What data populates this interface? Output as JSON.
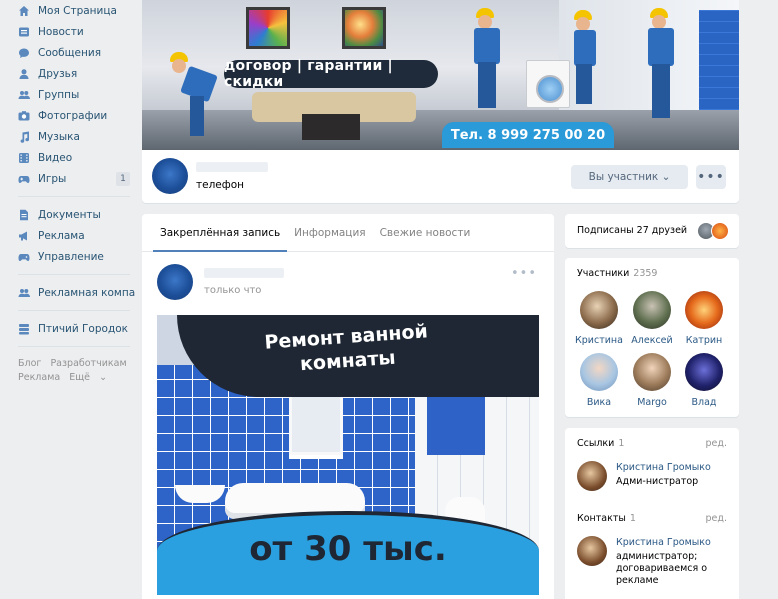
{
  "sidebar": {
    "items": [
      {
        "label": "Моя Страница",
        "icon": "home-icon"
      },
      {
        "label": "Новости",
        "icon": "news-icon"
      },
      {
        "label": "Сообщения",
        "icon": "messages-icon"
      },
      {
        "label": "Друзья",
        "icon": "friends-icon"
      },
      {
        "label": "Группы",
        "icon": "groups-icon"
      },
      {
        "label": "Фотографии",
        "icon": "photos-icon"
      },
      {
        "label": "Музыка",
        "icon": "music-icon"
      },
      {
        "label": "Видео",
        "icon": "video-icon"
      },
      {
        "label": "Игры",
        "icon": "games-icon",
        "badge": "1"
      }
    ],
    "items2": [
      {
        "label": "Документы",
        "icon": "documents-icon"
      },
      {
        "label": "Реклама",
        "icon": "ads-icon"
      },
      {
        "label": "Управление",
        "icon": "management-icon"
      }
    ],
    "items3": [
      {
        "label": "Рекламная компа",
        "icon": "ad-company-icon"
      }
    ],
    "items4": [
      {
        "label": "Птичий Городок",
        "icon": "bird-town-icon"
      }
    ],
    "footer": [
      "Блог",
      "Разработчикам",
      "Реклама",
      "Ещё"
    ]
  },
  "cover": {
    "banner": "договор | гарантии | скидки",
    "phone": "Тел. 8 999 275 00 20"
  },
  "group": {
    "status": "телефон",
    "member_button": "Вы участник ⌄",
    "more_button": "•••"
  },
  "wall": {
    "tabs": [
      "Закреплённая запись",
      "Информация",
      "Свежие новости"
    ],
    "post_time": "только что",
    "post_more": "•••",
    "image_title_line1": "Ремонт ванной",
    "image_title_line2": "комнаты",
    "image_price": "от 30 тыс."
  },
  "friends": {
    "text": "Подписаны 27 друзей"
  },
  "members": {
    "title": "Участники",
    "count": "2359",
    "list": [
      {
        "name": "Кристина"
      },
      {
        "name": "Алексей"
      },
      {
        "name": "Катрин"
      },
      {
        "name": "Вика"
      },
      {
        "name": "Margo"
      },
      {
        "name": "Влад"
      }
    ]
  },
  "links": {
    "title": "Ссылки",
    "count": "1",
    "edit": "ред.",
    "contact_name": "Кристина Громыко",
    "contact_role": "Адми-нистратор"
  },
  "contacts": {
    "title": "Контакты",
    "count": "1",
    "edit": "ред.",
    "contact_name": "Кристина Громыко",
    "contact_role": "администратор; договариваемся о рекламе"
  }
}
